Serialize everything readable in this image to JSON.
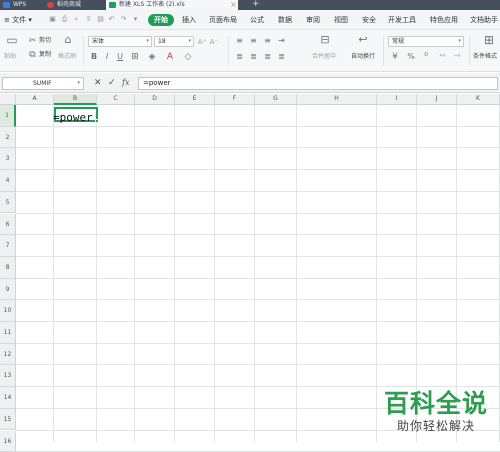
{
  "titlebar": {
    "tabs": [
      {
        "label": "WPS",
        "active": false
      },
      {
        "label": "稻壳商城",
        "active": false
      },
      {
        "label": "新建 XLS 工作表 (2).xls",
        "active": true
      }
    ],
    "close_label": "×",
    "new_tab_label": "+"
  },
  "menubar": {
    "file_label": "≡ 文件 ▾",
    "items": [
      "开始",
      "插入",
      "页面布局",
      "公式",
      "数据",
      "审阅",
      "视图",
      "安全",
      "开发工具",
      "特色应用",
      "文档助手"
    ]
  },
  "ribbon": {
    "cut_label": "剪切",
    "copy_label": "复制",
    "paste_label": "粘贴",
    "format_painter_label": "格式刷",
    "font_name": "宋体",
    "font_size": "18",
    "bold": "B",
    "italic": "I",
    "underline": "U",
    "merge_label": "合并居中",
    "wrap_label": "自动换行",
    "number_format": "常规",
    "cond_format_label": "条件格式"
  },
  "formula_bar": {
    "name_box": "SUMIF",
    "cancel": "✕",
    "confirm": "✓",
    "fx": "fx",
    "value": "=power"
  },
  "sheet": {
    "columns": [
      "A",
      "B",
      "C",
      "D",
      "E",
      "F",
      "G",
      "H",
      "I",
      "J",
      "K"
    ],
    "rows": [
      "1",
      "2",
      "3",
      "4",
      "5",
      "6",
      "7",
      "8",
      "9",
      "10",
      "11",
      "12",
      "13",
      "14",
      "15",
      "16"
    ],
    "selected_column": "B",
    "selected_row": "1",
    "active_cell_text": "=power"
  },
  "watermark": {
    "title": "百科全说",
    "subtitle": "助你轻松解决"
  },
  "colors": {
    "accent": "#1f9e55",
    "titlebar": "#46505d"
  }
}
